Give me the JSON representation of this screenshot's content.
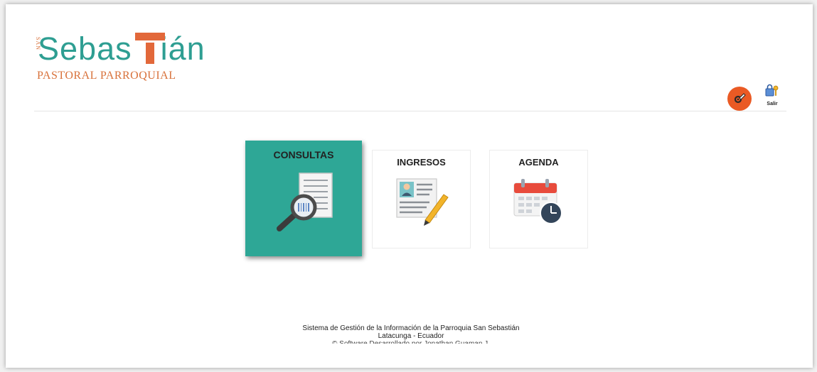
{
  "logo": {
    "word_before": "Sebas",
    "word_after": "ián",
    "small_vertical": "SAN",
    "subtitle": "PASTORAL PARROQUIAL",
    "colors": {
      "teal": "#2e9e92",
      "orange": "#d8713a"
    }
  },
  "header": {
    "settings_icon": "gear-wrench-icon",
    "logout_icon": "lock-key-icon",
    "logout_label": "Salir"
  },
  "tiles": [
    {
      "label": "CONSULTAS",
      "icon": "document-search-icon",
      "active": true,
      "color": "#2ea796"
    },
    {
      "label": "INGRESOS",
      "icon": "id-card-pencil-icon",
      "active": false
    },
    {
      "label": "AGENDA",
      "icon": "calendar-clock-icon",
      "active": false
    }
  ],
  "footer": {
    "line1": "Sistema de Gestión de la Información de la Parroquia San Sebastián",
    "line2": "Latacunga - Ecuador",
    "line3": "© Software Desarrollado por Jonathan Guaman J."
  },
  "colors": {
    "accent_orange": "#ea5a24",
    "accent_teal": "#2ea796"
  }
}
